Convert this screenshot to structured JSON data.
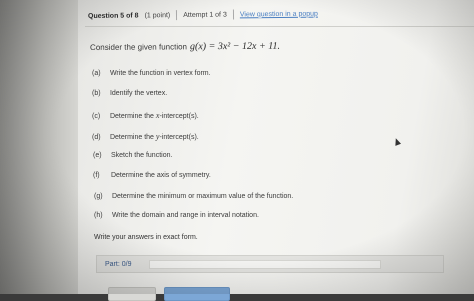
{
  "header": {
    "question": "Question 5 of 8",
    "points": "(1 point)",
    "attempt": "Attempt 1 of 3",
    "popup_link": "View question in a popup"
  },
  "prompt": {
    "lead": "Consider the given function",
    "function": "g(x) = 3x² − 12x + 11."
  },
  "items": [
    {
      "label": "(a)",
      "text": "Write the function in vertex form."
    },
    {
      "label": "(b)",
      "text": "Identify the vertex."
    },
    {
      "label": "(c)",
      "pre": "Determine the",
      "math": "x",
      "post": "-intercept(s)."
    },
    {
      "label": "(d)",
      "pre": "Determine the",
      "math": "y",
      "post": "-intercept(s)."
    },
    {
      "label": "(e)",
      "text": "Sketch the function."
    },
    {
      "label": "(f)",
      "text": "Determine the axis of symmetry."
    },
    {
      "label": "(g)",
      "text": "Determine the minimum or maximum value of the function."
    },
    {
      "label": "(h)",
      "text": "Write the domain and range in interval notation."
    }
  ],
  "instruction": "Write your answers in exact form.",
  "part": {
    "label": "Part: 0/9",
    "progress": 0
  },
  "colors": {
    "link": "#4a7fc2",
    "part_label": "#3a5a8a",
    "progress_fill": "#7aa7d8"
  }
}
